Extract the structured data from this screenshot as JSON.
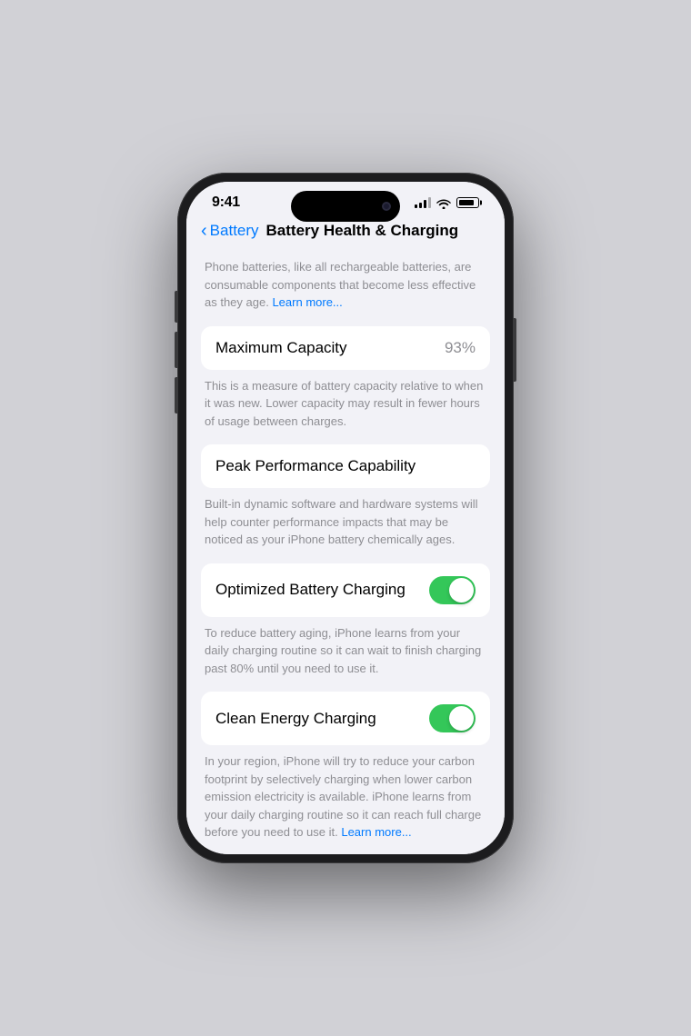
{
  "statusBar": {
    "time": "9:41"
  },
  "navigation": {
    "backLabel": "Battery",
    "pageTitle": "Battery Health & Charging"
  },
  "introText": "Phone batteries, like all rechargeable batteries, are consumable components that become less effective as they age.",
  "introLearnMore": "Learn more...",
  "sections": [
    {
      "id": "maximum-capacity",
      "label": "Maximum Capacity",
      "value": "93%",
      "description": "This is a measure of battery capacity relative to when it was new. Lower capacity may result in fewer hours of usage between charges."
    },
    {
      "id": "peak-performance",
      "label": "Peak Performance Capability",
      "value": null,
      "description": "Built-in dynamic software and hardware systems will help counter performance impacts that may be noticed as your iPhone battery chemically ages."
    },
    {
      "id": "optimized-charging",
      "label": "Optimized Battery Charging",
      "toggle": true,
      "toggleOn": true,
      "description": "To reduce battery aging, iPhone learns from your daily charging routine so it can wait to finish charging past 80% until you need to use it."
    },
    {
      "id": "clean-energy",
      "label": "Clean Energy Charging",
      "toggle": true,
      "toggleOn": true,
      "description": "In your region, iPhone will try to reduce your carbon footprint by selectively charging when lower carbon emission electricity is available. iPhone learns from your daily charging routine so it can reach full charge before you need to use it.",
      "learnMore": "Learn more..."
    }
  ]
}
